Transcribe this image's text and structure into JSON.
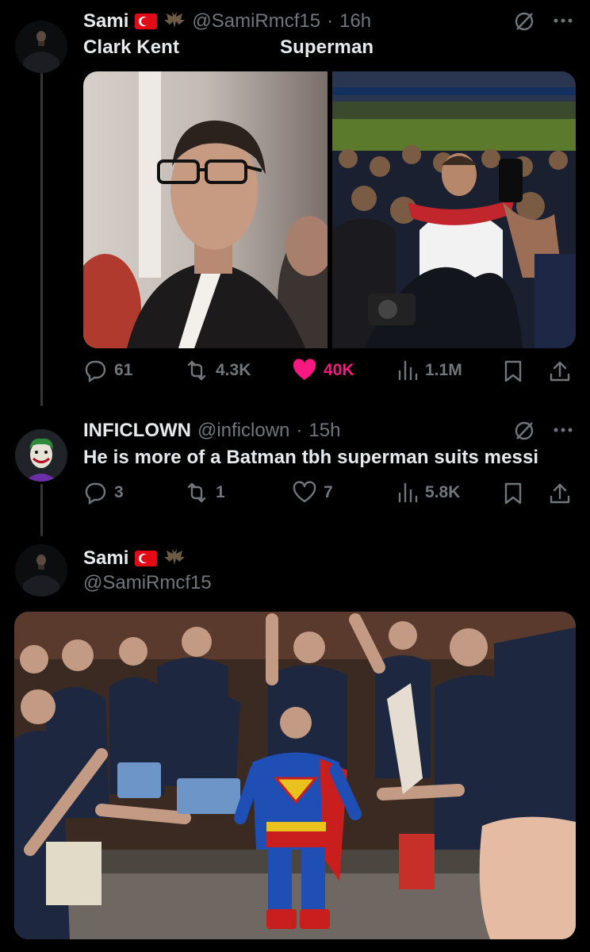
{
  "tweets": [
    {
      "author_name": "Sami",
      "handle": "@SamiRmcf15",
      "separator": "·",
      "time": "16h",
      "text_left": "Clark Kent",
      "text_right": "Superman",
      "media": [
        {
          "icon": "portrait-photo-icon",
          "description_icon": "man-in-suit-glasses"
        },
        {
          "icon": "crowd-photo-icon",
          "description_icon": "player-in-crowd"
        }
      ],
      "stats": {
        "replies": "61",
        "reposts": "4.3K",
        "likes": "40K",
        "views": "1.1M"
      }
    },
    {
      "author_name": "INFICLOWN",
      "handle": "@inficlown",
      "separator": "·",
      "time": "15h",
      "text": "He is more of a Batman tbh superman suits messi",
      "stats": {
        "replies": "3",
        "reposts": "1",
        "likes": "7",
        "views": "5.8K"
      }
    },
    {
      "author_name": "Sami",
      "handle": "@SamiRmcf15",
      "media": [
        {
          "icon": "group-photo-icon"
        }
      ]
    }
  ],
  "colors": {
    "background": "#000000",
    "text": "#e7e9ea",
    "muted": "#71767b",
    "like_active": "#f91880",
    "turkey_flag": "#e30a17"
  }
}
